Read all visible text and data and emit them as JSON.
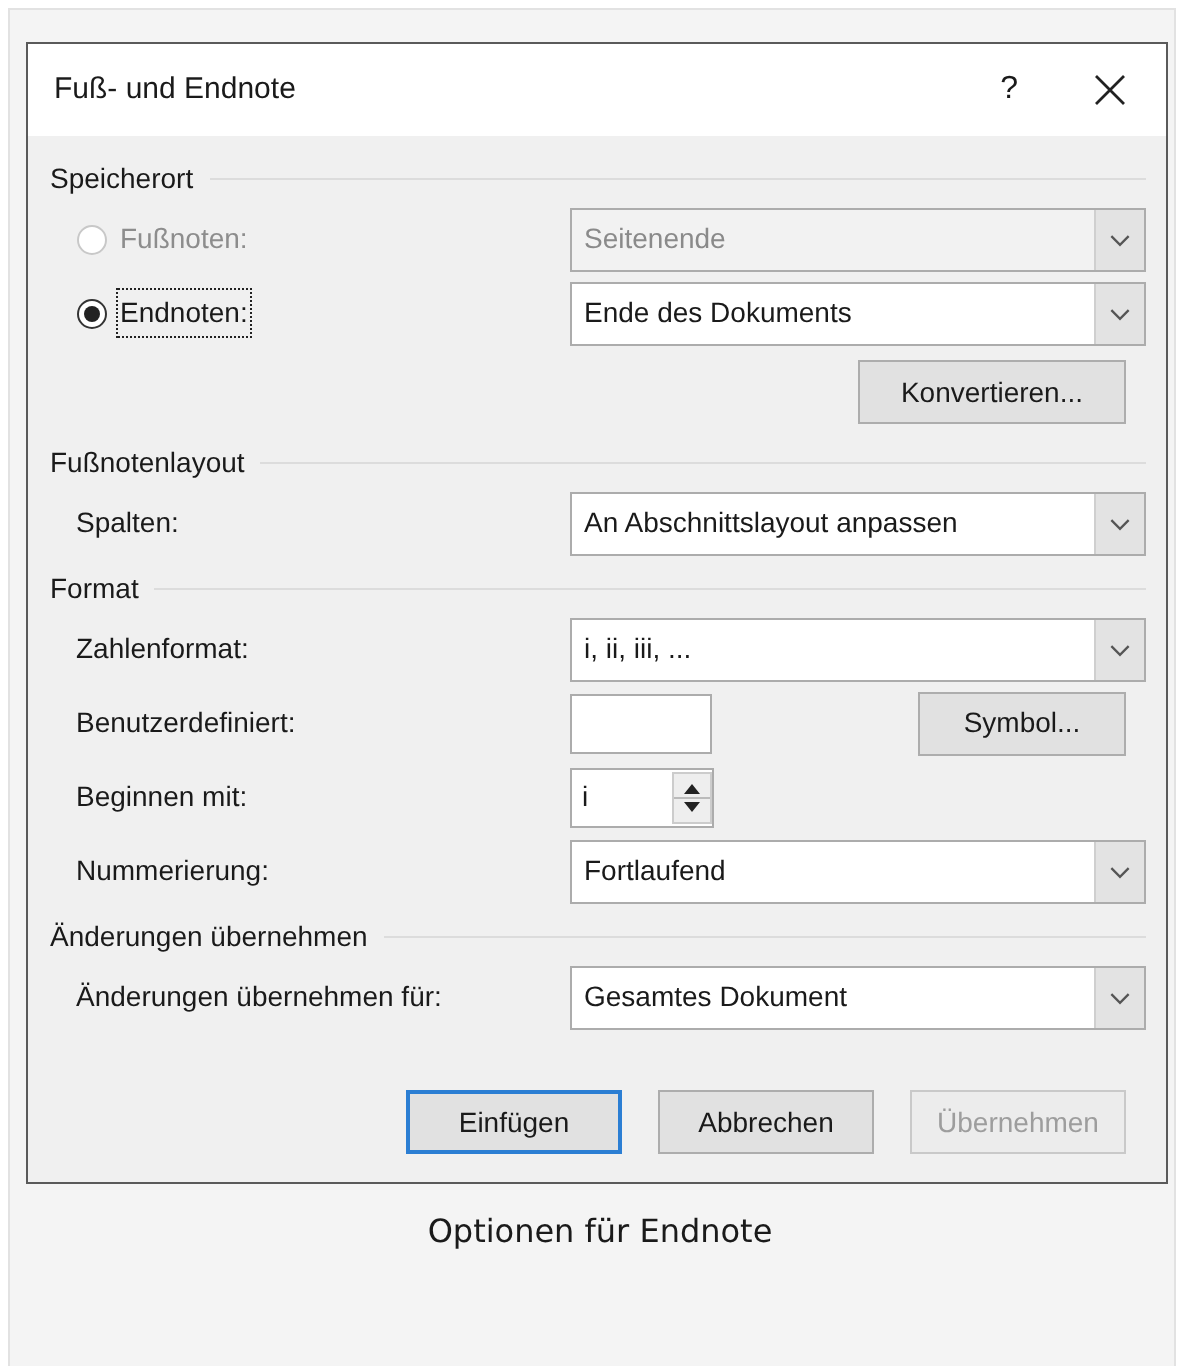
{
  "window": {
    "title": "Fuß- und Endnote",
    "help": "?"
  },
  "sections": [
    {
      "title": "Speicherort",
      "rows": [
        {
          "kind": "radio",
          "label": "Fußnoten:",
          "selected": false,
          "disabled": true,
          "focused": false,
          "value": "Seitenende"
        },
        {
          "kind": "radio",
          "label": "Endnoten:",
          "selected": true,
          "disabled": false,
          "focused": true,
          "value": "Ende des Dokuments"
        },
        {
          "kind": "action",
          "button": "Konvertieren..."
        }
      ]
    },
    {
      "title": "Fußnotenlayout",
      "rows": [
        {
          "kind": "select",
          "label": "Spalten:",
          "value": "An Abschnittslayout anpassen"
        }
      ]
    },
    {
      "title": "Format",
      "rows": [
        {
          "kind": "select",
          "label": "Zahlenformat:",
          "value": "i, ii, iii, ..."
        },
        {
          "kind": "input",
          "label": "Benutzerdefiniert:",
          "button": "Symbol..."
        },
        {
          "kind": "spinner",
          "label": "Beginnen mit:",
          "value": "i"
        },
        {
          "kind": "select",
          "label": "Nummerierung:",
          "value": "Fortlaufend"
        }
      ]
    },
    {
      "title": "Änderungen übernehmen",
      "rows": [
        {
          "kind": "select",
          "label": "Änderungen übernehmen für:",
          "value": "Gesamtes Dokument"
        }
      ]
    }
  ],
  "buttons": [
    {
      "label": "Einfügen",
      "default": true,
      "disabled": false
    },
    {
      "label": "Abbrechen",
      "default": false,
      "disabled": false
    },
    {
      "label": "Übernehmen",
      "default": false,
      "disabled": true
    }
  ],
  "caption": "Optionen für Endnote"
}
